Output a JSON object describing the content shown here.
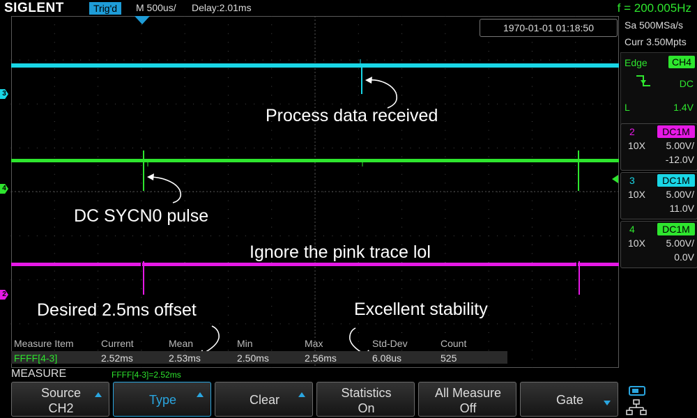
{
  "topbar": {
    "brand": "SIGLENT",
    "trigger_status": "Trig'd",
    "timebase": "M 500us/",
    "delay": "Delay:2.01ms",
    "frequency": "f = 200.005Hz"
  },
  "timestamp": "1970-01-01 01:18:50",
  "acquisition": {
    "sample_rate": "Sa 500MSa/s",
    "memory_depth": "Curr 3.50Mpts"
  },
  "trigger": {
    "type": "Edge",
    "source": "CH4",
    "slope_icon": "falling-edge-icon",
    "coupling": "DC",
    "level_label": "L",
    "level": "1.4V"
  },
  "channels": [
    {
      "num": "2",
      "coupling": "DC1M",
      "probe": "10X",
      "scale": "5.00V/",
      "offset": "-12.0V",
      "color": "#e619e6"
    },
    {
      "num": "3",
      "coupling": "DC1M",
      "probe": "10X",
      "scale": "5.00V/",
      "offset": "11.0V",
      "color": "#19d6e6"
    },
    {
      "num": "4",
      "coupling": "DC1M",
      "probe": "10X",
      "scale": "5.00V/",
      "offset": "0.0V",
      "color": "#2ee52e"
    }
  ],
  "ground_markers": {
    "ch3": "3",
    "ch4": "4",
    "ch2": "2"
  },
  "annotations": {
    "process_data": "Process data received",
    "dc_sync": "DC SYCN0 pulse",
    "pink_trace": "Ignore the pink trace lol",
    "offset": "Desired 2.5ms offset",
    "stability": "Excellent stability"
  },
  "measure": {
    "headers": [
      "Measure Item",
      "Current",
      "Mean",
      "Min",
      "Max",
      "Std-Dev",
      "Count"
    ],
    "row": [
      "FFFF[4-3]",
      "2.52ms",
      "2.53ms",
      "2.50ms",
      "2.56ms",
      "6.08us",
      "525"
    ]
  },
  "menu": {
    "title": "MEASURE",
    "formula": "FFFF[4-3]=2.52ms",
    "softkeys": [
      {
        "line1": "Source",
        "line2": "CH2"
      },
      {
        "line1": "Type",
        "line2": ""
      },
      {
        "line1": "Clear",
        "line2": ""
      },
      {
        "line1": "Statistics",
        "line2": "On"
      },
      {
        "line1": "All Measure",
        "line2": "Off"
      },
      {
        "line1": "Gate",
        "line2": ""
      }
    ]
  },
  "colors": {
    "ch2": "#e619e6",
    "ch3": "#19d6e6",
    "ch4": "#2ee52e",
    "trigger_accent": "#1e9cd7"
  }
}
